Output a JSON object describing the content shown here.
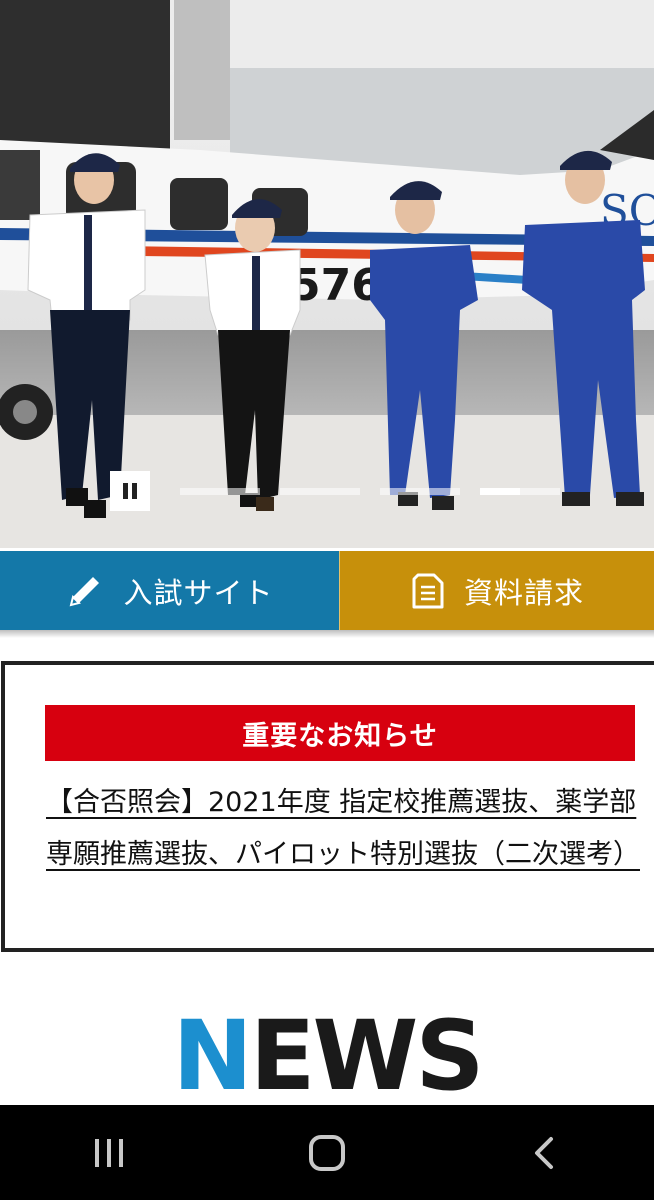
{
  "hero": {
    "image_description_icon": "photo-pilots-walking",
    "aircraft_marking": "576",
    "aircraft_logo_text": "SOJ",
    "slider": {
      "slide_count": 4,
      "active_slide": 4,
      "active_progress": 0.5
    },
    "pause_icon": "pause-icon"
  },
  "cta": {
    "admission_label": "入試サイト",
    "admission_icon": "pencil-icon",
    "request_label": "資料請求",
    "request_icon": "document-icon",
    "colors": {
      "admission": "#1478a8",
      "request": "#c7900b"
    }
  },
  "notice": {
    "heading": "重要なお知らせ",
    "link_text": "【合否照会】2021年度 指定校推薦選抜、薬学部専願推薦選抜、パイロット特別選抜（二次選考）",
    "heading_color": "#d7000f"
  },
  "news": {
    "title_first_letter": "N",
    "title_rest": "EWS",
    "accent_color": "#1c8fcf"
  },
  "android_nav": {
    "recent_icon": "recent-apps-icon",
    "home_icon": "home-icon",
    "back_icon": "back-icon"
  }
}
